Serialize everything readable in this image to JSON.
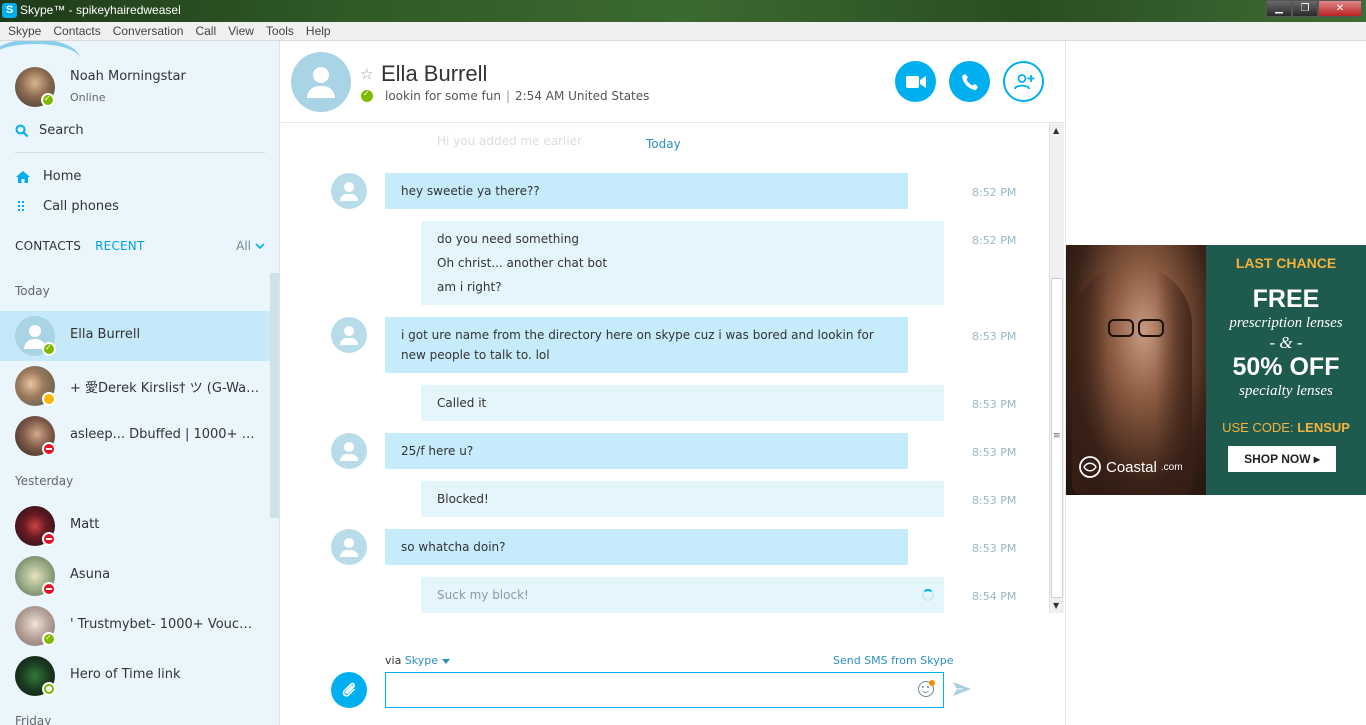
{
  "window": {
    "title": "Skype™ - spikeyhairedweasel",
    "controls": [
      "▁",
      "❐",
      "✕"
    ]
  },
  "menu": [
    "Skype",
    "Contacts",
    "Conversation",
    "Call",
    "View",
    "Tools",
    "Help"
  ],
  "profile": {
    "name": "Noah Morningstar",
    "status": "Online"
  },
  "sidebar": {
    "search_label": "Search",
    "home_label": "Home",
    "call_phones_label": "Call phones",
    "tabs": [
      "CONTACTS",
      "RECENT"
    ],
    "filter_label": "All",
    "sections": [
      {
        "title": "Today",
        "contacts": [
          {
            "name": "Ella Burrell",
            "status": "online"
          },
          {
            "name": "+ 愛Derek Kirslis† ツ (G-Wash...",
            "status": "away"
          },
          {
            "name": "asleep... Dbuffed | 1000+ Fee...",
            "status": "dnd"
          }
        ]
      },
      {
        "title": "Yesterday",
        "contacts": [
          {
            "name": "Matt",
            "status": "dnd"
          },
          {
            "name": "Asuna",
            "status": "dnd"
          },
          {
            "name": "' Trustmybet- 1000+ Vouches!...",
            "status": "online"
          },
          {
            "name": "Hero of Time link",
            "status": "offline"
          }
        ]
      },
      {
        "title": "Friday",
        "contacts": []
      }
    ]
  },
  "conversation": {
    "name": "Ella Burrell",
    "mood": "lookin for some fun",
    "local_time": "2:54 AM United States",
    "day_label": "Today",
    "faded_text": "Hi you added me earlier",
    "messages": [
      {
        "dir": "in",
        "lines": [
          "hey sweetie ya there??"
        ],
        "time": "8:52 PM"
      },
      {
        "dir": "out",
        "lines": [
          "do you need something",
          "Oh christ... another chat bot",
          "am i right?"
        ],
        "time": "8:52 PM"
      },
      {
        "dir": "in",
        "lines": [
          "i got ure name from the directory here on skype cuz i was bored and lookin for new people to talk to. lol"
        ],
        "time": "8:53 PM"
      },
      {
        "dir": "out",
        "lines": [
          "Called it"
        ],
        "time": "8:53 PM"
      },
      {
        "dir": "in",
        "lines": [
          "25/f here u?"
        ],
        "time": "8:53 PM"
      },
      {
        "dir": "out",
        "lines": [
          "Blocked!"
        ],
        "time": "8:53 PM"
      },
      {
        "dir": "in",
        "lines": [
          "so whatcha doin?"
        ],
        "time": "8:53 PM"
      },
      {
        "dir": "out",
        "lines": [
          "Suck my block!"
        ],
        "time": "8:54 PM",
        "pending": true
      }
    ]
  },
  "compose": {
    "via_label": "via",
    "via_service": "Skype",
    "sms_link": "Send SMS from Skype",
    "value": ""
  },
  "ad": {
    "headline": "LAST CHANCE",
    "free": "FREE",
    "prescription": "prescription lenses",
    "amp": "- & -",
    "percent": "50% OFF",
    "specialty": "specialty lenses",
    "code_label": "USE CODE:",
    "code": "LENSUP",
    "cta": "SHOP NOW ▸",
    "brand": "Coastal",
    "brand_suffix": ".com"
  },
  "colors": {
    "accent": "#00aff0",
    "online": "#7fba00",
    "away": "#fcb800",
    "dnd": "#e81123"
  }
}
